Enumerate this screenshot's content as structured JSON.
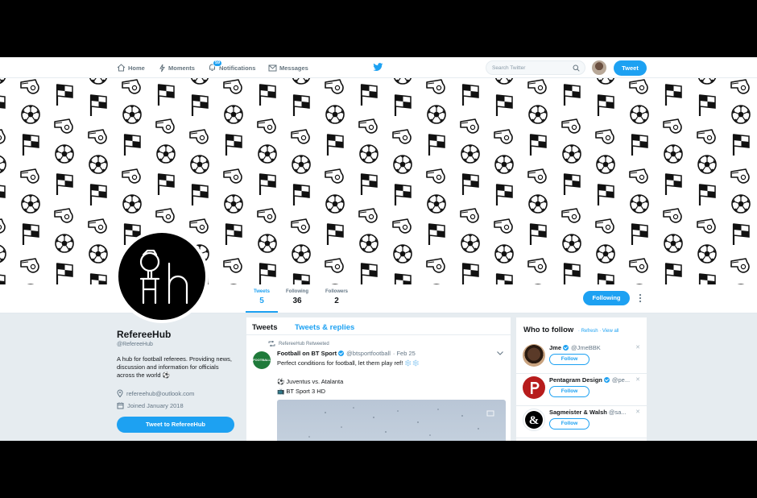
{
  "nav": {
    "home": "Home",
    "moments": "Moments",
    "notifications": "Notifications",
    "notifications_count": "59",
    "messages": "Messages",
    "search_placeholder": "Search Twitter",
    "tweet_button": "Tweet"
  },
  "banner": {
    "pattern_icons": [
      "soccer-ball-icon",
      "whistle-icon",
      "corner-flag-icon"
    ]
  },
  "profile_nav": {
    "stats": [
      {
        "label": "Tweets",
        "value": "5"
      },
      {
        "label": "Following",
        "value": "36"
      },
      {
        "label": "Followers",
        "value": "2"
      }
    ],
    "following_button": "Following"
  },
  "profile": {
    "name": "RefereeHub",
    "handle": "@RefereeHub",
    "bio": "A hub for football referees. Providing news, discussion and information for officials across the world ⚽",
    "email": "refereehub@outlook.com",
    "joined": "Joined January 2018",
    "tweet_to_button": "Tweet to RefereeHub"
  },
  "timeline": {
    "tabs": [
      "Tweets",
      "Tweets & replies"
    ],
    "tweet": {
      "retweet_note": "RefereeHub Retweeted",
      "avatar_label": "FOOTBALL",
      "author_name": "Football on BT Sport",
      "author_handle": "@btsportfootball",
      "date": "· Feb 25",
      "text_line1": "Perfect conditions for football, let them play ref! ❄️❄️",
      "text_line2": "⚽ Juventus vs. Atalanta",
      "text_line3": "📺 BT Sport 3 HD"
    }
  },
  "who_to_follow": {
    "title": "Who to follow",
    "links": "· Refresh · View all",
    "accounts": [
      {
        "name": "Jme",
        "handle": "@JmeBBK",
        "follow": "Follow"
      },
      {
        "name": "Pentagram Design",
        "handle": "@pe...",
        "follow": "Follow"
      },
      {
        "name": "Sagmeister & Walsh",
        "handle": "@sa...",
        "follow": "Follow"
      }
    ]
  },
  "colors": {
    "accent": "#1da1f2",
    "background": "#e6ecf0"
  }
}
